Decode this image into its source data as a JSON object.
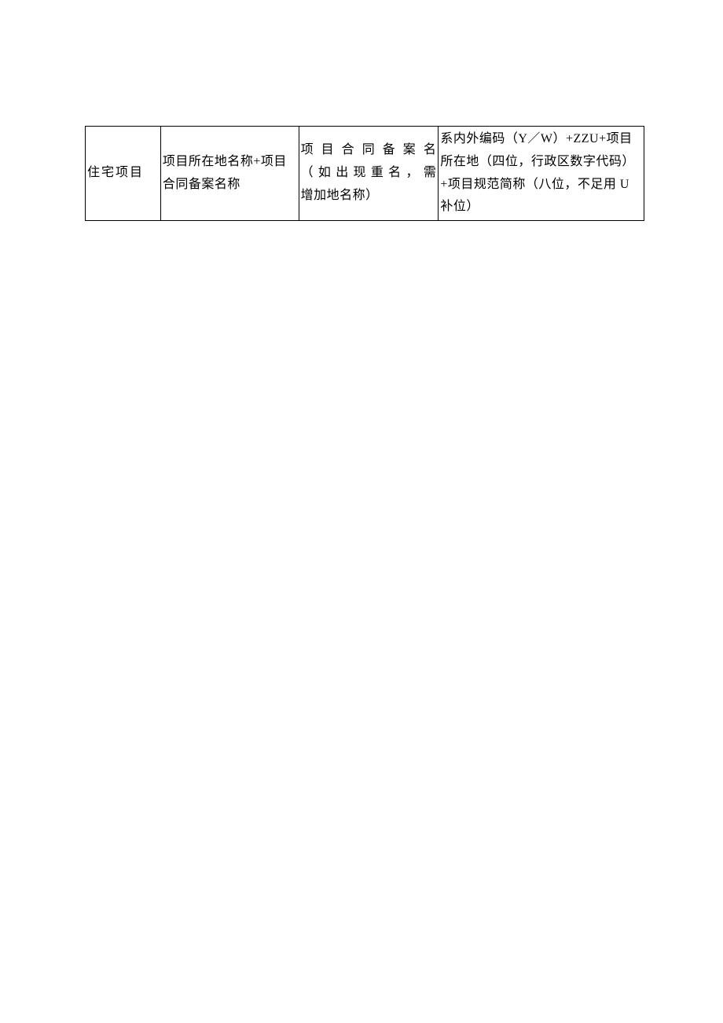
{
  "table": {
    "row1": {
      "cell1": "住宅项目",
      "cell2": "项目所在地名称+项目合同备案名称",
      "cell3_line1": "项目合同备案名",
      "cell3_line2": "（如出现重名，需",
      "cell3_line3": "增加地名称）",
      "cell4": "系内外编码（Y／W）+ZZU+项目所在地（四位，行政区数字代码）+项目规范简称（八位，不足用 U 补位）"
    }
  }
}
